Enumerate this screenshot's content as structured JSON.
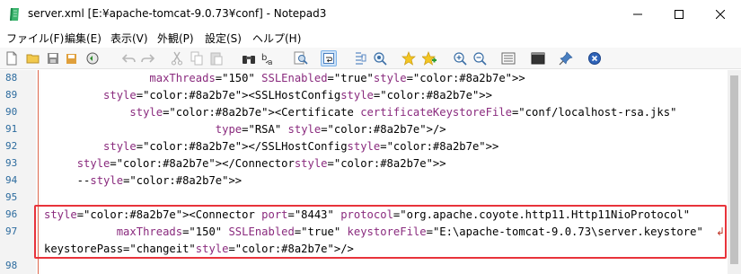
{
  "window": {
    "title": "server.xml [E:¥apache-tomcat-9.0.73¥conf] - Notepad3"
  },
  "menu": [
    "ファイル(F)",
    "編集(E)",
    "表示(V)",
    "外観(P)",
    "設定(S)",
    "ヘルプ(H)"
  ],
  "toolbar": {
    "icons": [
      "new-file-icon",
      "open-folder-icon",
      "save-icon",
      "save-as-icon",
      "browse-icon",
      "undo-icon",
      "redo-icon",
      "cut-icon",
      "copy-icon",
      "paste-icon",
      "find-icon",
      "replace-icon",
      "search-icon",
      "word-wrap-icon",
      "selection-icon",
      "zoom-find-icon",
      "add-favorite-icon",
      "manage-favorites-icon",
      "zoom-in-icon",
      "zoom-out-icon",
      "settings-icon",
      "terminal-icon",
      "pin-icon",
      "close-icon"
    ]
  },
  "colors": {
    "highlight_border": "#e8333b",
    "line_number": "#2c6b9e"
  },
  "editor": {
    "lines": [
      {
        "num": "88",
        "text": "                maxThreads=\"150\" SSLEnabled=\"true\">"
      },
      {
        "num": "89",
        "text": "         <SSLHostConfig>"
      },
      {
        "num": "90",
        "text": "             <Certificate certificateKeystoreFile=\"conf/localhost-rsa.jks\""
      },
      {
        "num": "91",
        "text": "                          type=\"RSA\" />"
      },
      {
        "num": "92",
        "text": "         </SSLHostConfig>"
      },
      {
        "num": "93",
        "text": "     </Connector>"
      },
      {
        "num": "94",
        "text": "     -->"
      },
      {
        "num": "95",
        "text": ""
      },
      {
        "num": "96",
        "text": "<Connector port=\"8443\" protocol=\"org.apache.coyote.http11.Http11NioProtocol\""
      },
      {
        "num": "97",
        "text": "           maxThreads=\"150\" SSLEnabled=\"true\" keystoreFile=\"E:\\apache-tomcat-9.0.73\\server.keystore\""
      },
      {
        "num": "",
        "text": "keystorePass=\"changeit\"/>"
      },
      {
        "num": "98",
        "text": ""
      }
    ]
  }
}
